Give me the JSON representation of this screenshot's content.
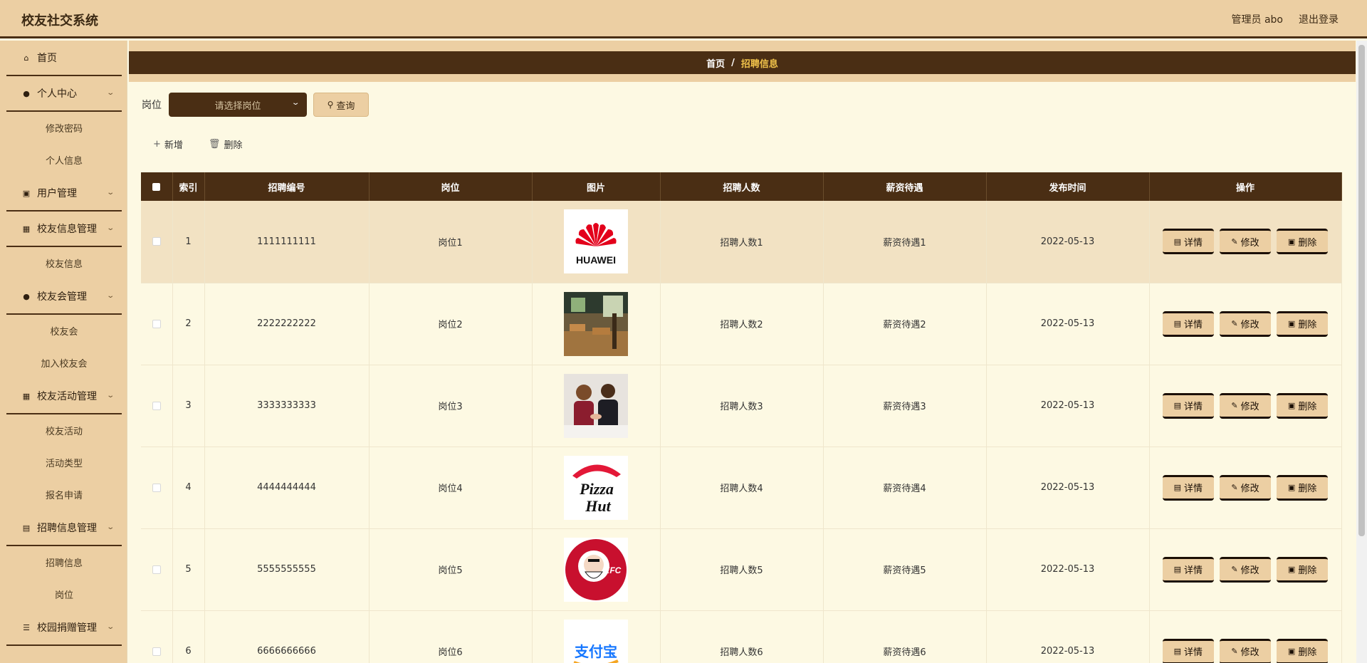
{
  "app": {
    "title": "校友社交系统"
  },
  "topbar": {
    "user": "管理员 abo",
    "logout": "退出登录"
  },
  "sidebar": {
    "items": [
      {
        "type": "group",
        "label": "首页",
        "icon": "home-icon",
        "chevron": false
      },
      {
        "type": "group",
        "label": "个人中心",
        "icon": "user-icon",
        "chevron": true
      },
      {
        "type": "sub",
        "label": "修改密码"
      },
      {
        "type": "sub",
        "label": "个人信息"
      },
      {
        "type": "group",
        "label": "用户管理",
        "icon": "lock-icon",
        "chevron": true
      },
      {
        "type": "group",
        "label": "校友信息管理",
        "icon": "grid-icon",
        "chevron": true
      },
      {
        "type": "sub",
        "label": "校友信息"
      },
      {
        "type": "group",
        "label": "校友会管理",
        "icon": "user-icon",
        "chevron": true
      },
      {
        "type": "sub",
        "label": "校友会"
      },
      {
        "type": "sub",
        "label": "加入校友会"
      },
      {
        "type": "group",
        "label": "校友活动管理",
        "icon": "grid-icon",
        "chevron": true
      },
      {
        "type": "sub",
        "label": "校友活动"
      },
      {
        "type": "sub",
        "label": "活动类型"
      },
      {
        "type": "sub",
        "label": "报名申请"
      },
      {
        "type": "group",
        "label": "招聘信息管理",
        "icon": "clipboard-icon",
        "chevron": true
      },
      {
        "type": "sub",
        "label": "招聘信息"
      },
      {
        "type": "sub",
        "label": "岗位"
      },
      {
        "type": "group",
        "label": "校园捐赠管理",
        "icon": "sliders-icon",
        "chevron": true
      }
    ]
  },
  "breadcrumb": {
    "home": "首页",
    "sep": "/",
    "current": "招聘信息"
  },
  "search": {
    "label": "岗位",
    "placeholder": "请选择岗位",
    "query": "查询"
  },
  "actions": {
    "add": "新增",
    "delete": "删除"
  },
  "table": {
    "headers": [
      "索引",
      "招聘编号",
      "岗位",
      "图片",
      "招聘人数",
      "薪资待遇",
      "发布时间",
      "操作"
    ],
    "buttons": {
      "detail": "详情",
      "edit": "修改",
      "remove": "删除"
    },
    "rows": [
      {
        "index": "1",
        "code": "1111111111",
        "post": "岗位1",
        "image": "huawei-logo",
        "count": "招聘人数1",
        "salary": "薪资待遇1",
        "date": "2022-05-13"
      },
      {
        "index": "2",
        "code": "2222222222",
        "post": "岗位2",
        "image": "office-photo",
        "count": "招聘人数2",
        "salary": "薪资待遇2",
        "date": "2022-05-13"
      },
      {
        "index": "3",
        "code": "3333333333",
        "post": "岗位3",
        "image": "handshake-photo",
        "count": "招聘人数3",
        "salary": "薪资待遇3",
        "date": "2022-05-13"
      },
      {
        "index": "4",
        "code": "4444444444",
        "post": "岗位4",
        "image": "pizzahut-logo",
        "count": "招聘人数4",
        "salary": "薪资待遇4",
        "date": "2022-05-13"
      },
      {
        "index": "5",
        "code": "5555555555",
        "post": "岗位5",
        "image": "kfc-logo",
        "count": "招聘人数5",
        "salary": "薪资待遇5",
        "date": "2022-05-13"
      },
      {
        "index": "6",
        "code": "6666666666",
        "post": "岗位6",
        "image": "alipay-logo",
        "count": "招聘人数6",
        "salary": "薪资待遇6",
        "date": "2022-05-13"
      }
    ]
  },
  "logos": {
    "huawei": "HUAWEI",
    "pizzahut_1": "Pizza",
    "pizzahut_2": "Hut",
    "kfc": "KFC",
    "alipay": "支付宝"
  }
}
